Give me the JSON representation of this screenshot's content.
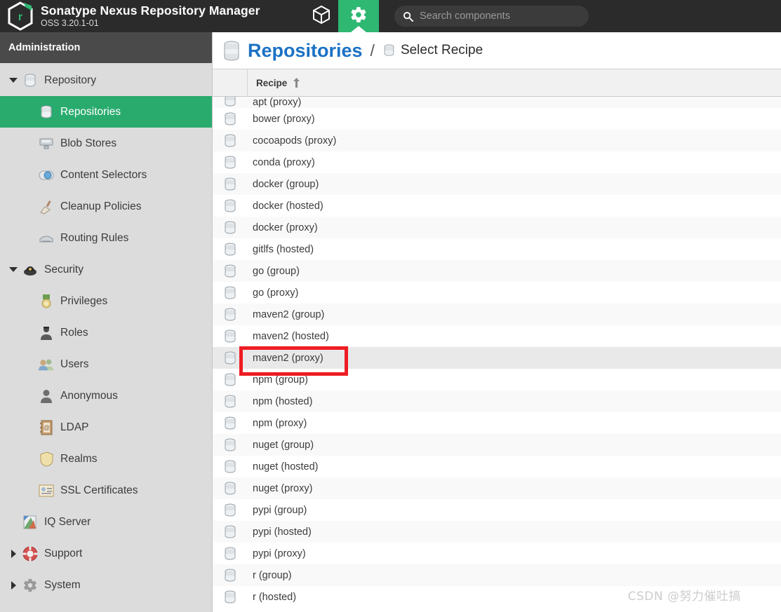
{
  "header": {
    "brand_title": "Sonatype Nexus Repository Manager",
    "brand_version": "OSS 3.20.1-01",
    "logo_letter": "r",
    "cube_icon": "cube-icon",
    "gear_icon": "gear-icon",
    "search": {
      "icon": "search-icon",
      "value": "",
      "placeholder": "Search components"
    },
    "accent_green": "#2eb872",
    "bar_background": "#2b2b2b"
  },
  "sidebar": {
    "section_title": "Administration",
    "selected_green": "#2aab6e",
    "items": [
      {
        "label": "Repository",
        "level": 0,
        "icon": "database-icon",
        "toggle": "down",
        "selected": false
      },
      {
        "label": "Repositories",
        "level": 1,
        "icon": "database-icon",
        "toggle": "none",
        "selected": true
      },
      {
        "label": "Blob Stores",
        "level": 1,
        "icon": "blob-store-icon",
        "toggle": "none",
        "selected": false
      },
      {
        "label": "Content Selectors",
        "level": 1,
        "icon": "content-selector-icon",
        "toggle": "none",
        "selected": false
      },
      {
        "label": "Cleanup Policies",
        "level": 1,
        "icon": "broom-icon",
        "toggle": "none",
        "selected": false
      },
      {
        "label": "Routing Rules",
        "level": 1,
        "icon": "routing-rules-icon",
        "toggle": "none",
        "selected": false
      },
      {
        "label": "Security",
        "level": 0,
        "icon": "security-shield-icon",
        "toggle": "down",
        "selected": false
      },
      {
        "label": "Privileges",
        "level": 1,
        "icon": "medal-icon",
        "toggle": "none",
        "selected": false
      },
      {
        "label": "Roles",
        "level": 1,
        "icon": "role-person-icon",
        "toggle": "none",
        "selected": false
      },
      {
        "label": "Users",
        "level": 1,
        "icon": "users-icon",
        "toggle": "none",
        "selected": false
      },
      {
        "label": "Anonymous",
        "level": 1,
        "icon": "anonymous-user-icon",
        "toggle": "none",
        "selected": false
      },
      {
        "label": "LDAP",
        "level": 1,
        "icon": "ldap-book-icon",
        "toggle": "none",
        "selected": false
      },
      {
        "label": "Realms",
        "level": 1,
        "icon": "shield-icon",
        "toggle": "none",
        "selected": false
      },
      {
        "label": "SSL Certificates",
        "level": 1,
        "icon": "certificate-icon",
        "toggle": "none",
        "selected": false
      },
      {
        "label": "IQ Server",
        "level": 0,
        "icon": "iq-server-icon",
        "toggle": "none",
        "selected": false
      },
      {
        "label": "Support",
        "level": 0,
        "icon": "lifebuoy-icon",
        "toggle": "right",
        "selected": false
      },
      {
        "label": "System",
        "level": 0,
        "icon": "system-gear-icon",
        "toggle": "right",
        "selected": false
      }
    ]
  },
  "breadcrumb": {
    "icon": "database-icon",
    "main": "Repositories",
    "separator": "/",
    "sub_icon": "database-small-icon",
    "sub": "Select Recipe",
    "link_color": "#1c72c4"
  },
  "grid": {
    "columns": [
      {
        "label": "",
        "key": "icon"
      },
      {
        "label": "Recipe",
        "key": "recipe",
        "sort": "asc",
        "sort_glyph": "↑"
      }
    ],
    "row_icon": "database-icon",
    "rows": [
      {
        "recipe": "apt (proxy)",
        "clipped": true,
        "hover": false
      },
      {
        "recipe": "bower (proxy)",
        "clipped": false,
        "hover": false
      },
      {
        "recipe": "cocoapods (proxy)",
        "clipped": false,
        "hover": false
      },
      {
        "recipe": "conda (proxy)",
        "clipped": false,
        "hover": false
      },
      {
        "recipe": "docker (group)",
        "clipped": false,
        "hover": false
      },
      {
        "recipe": "docker (hosted)",
        "clipped": false,
        "hover": false
      },
      {
        "recipe": "docker (proxy)",
        "clipped": false,
        "hover": false
      },
      {
        "recipe": "gitlfs (hosted)",
        "clipped": false,
        "hover": false
      },
      {
        "recipe": "go (group)",
        "clipped": false,
        "hover": false
      },
      {
        "recipe": "go (proxy)",
        "clipped": false,
        "hover": false
      },
      {
        "recipe": "maven2 (group)",
        "clipped": false,
        "hover": false
      },
      {
        "recipe": "maven2 (hosted)",
        "clipped": false,
        "hover": false
      },
      {
        "recipe": "maven2 (proxy)",
        "clipped": false,
        "hover": true
      },
      {
        "recipe": "npm (group)",
        "clipped": false,
        "hover": false
      },
      {
        "recipe": "npm (hosted)",
        "clipped": false,
        "hover": false
      },
      {
        "recipe": "npm (proxy)",
        "clipped": false,
        "hover": false
      },
      {
        "recipe": "nuget (group)",
        "clipped": false,
        "hover": false
      },
      {
        "recipe": "nuget (hosted)",
        "clipped": false,
        "hover": false
      },
      {
        "recipe": "nuget (proxy)",
        "clipped": false,
        "hover": false
      },
      {
        "recipe": "pypi (group)",
        "clipped": false,
        "hover": false
      },
      {
        "recipe": "pypi (hosted)",
        "clipped": false,
        "hover": false
      },
      {
        "recipe": "pypi (proxy)",
        "clipped": false,
        "hover": false
      },
      {
        "recipe": "r (group)",
        "clipped": false,
        "hover": false
      },
      {
        "recipe": "r (hosted)",
        "clipped": false,
        "hover": false
      }
    ]
  },
  "annotation": {
    "type": "highlight-rectangle",
    "color": "#ee1d23",
    "target_row": "maven2 (proxy)"
  },
  "watermark": {
    "text": "CSDN @努力催吐搞"
  }
}
